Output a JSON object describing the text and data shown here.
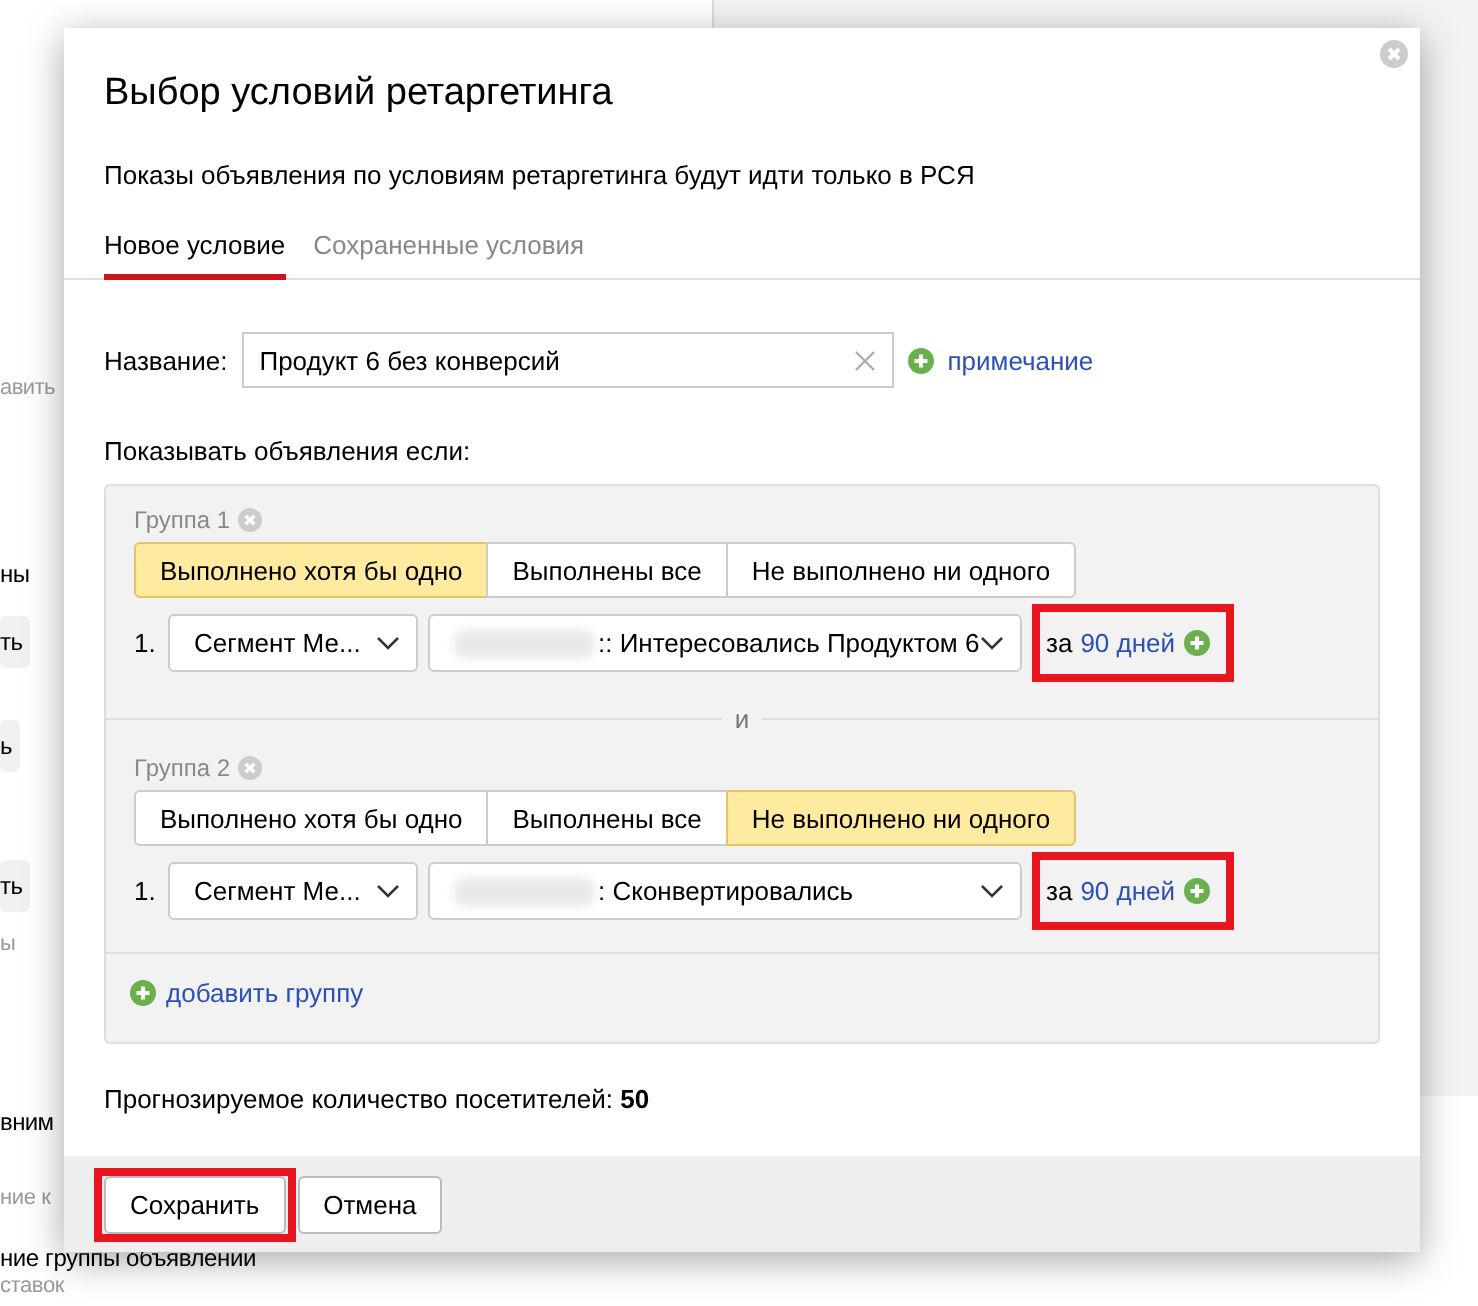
{
  "background": [
    {
      "kind": "hint",
      "text": "авить"
    },
    {
      "kind": "text",
      "text": "ны"
    },
    {
      "kind": "button",
      "text": "ть"
    },
    {
      "kind": "button",
      "text": "ь"
    },
    {
      "kind": "button",
      "text": "ть"
    },
    {
      "kind": "hint",
      "text": "ы"
    },
    {
      "kind": "text",
      "text": "вним"
    }
  ],
  "background_below": [
    {
      "kind": "hint",
      "text": "ние к"
    },
    {
      "kind": "text",
      "text": "ние группы объявлений"
    },
    {
      "kind": "hint",
      "text": "ставок"
    }
  ],
  "dialog": {
    "title": "Выбор условий ретаргетинга",
    "subtitle": "Показы объявления по условиям ретаргетинга будут идти только в РСЯ",
    "tabs": [
      {
        "label": "Новое условие",
        "selected": true
      },
      {
        "label": "Сохраненные условия",
        "selected": false
      }
    ],
    "name_label": "Название:",
    "name_value": "Продукт 6 без конверсий",
    "note_link": "примечание",
    "condition_label": "Показывать объявления если:",
    "groups": [
      {
        "title": "Группа 1",
        "modes": [
          {
            "label": "Выполнено хотя бы одно",
            "selected": true
          },
          {
            "label": "Выполнены все",
            "selected": false
          },
          {
            "label": "Не выполнено ни одного",
            "selected": false
          }
        ],
        "rules": [
          {
            "number": "1.",
            "source": "Сегмент Ме...",
            "goal": ":: Интересовались Продуктом 6",
            "period_prefix": "за",
            "period": "90 дней",
            "highlighted": true
          }
        ]
      },
      {
        "title": "Группа 2",
        "modes": [
          {
            "label": "Выполнено хотя бы одно",
            "selected": false
          },
          {
            "label": "Выполнены все",
            "selected": false
          },
          {
            "label": "Не выполнено ни одного",
            "selected": true
          }
        ],
        "rules": [
          {
            "number": "1.",
            "source": "Сегмент Ме...",
            "goal": ": Сконвертировались",
            "period_prefix": "за",
            "period": "90 дней",
            "highlighted": true
          }
        ]
      }
    ],
    "joiner": "и",
    "add_group": "добавить группу",
    "forecast_label": "Прогнозируемое количество посетителей:",
    "forecast_value": "50",
    "buttons": [
      {
        "label": "Сохранить",
        "highlighted": true
      },
      {
        "label": "Отмена",
        "highlighted": false
      }
    ]
  }
}
